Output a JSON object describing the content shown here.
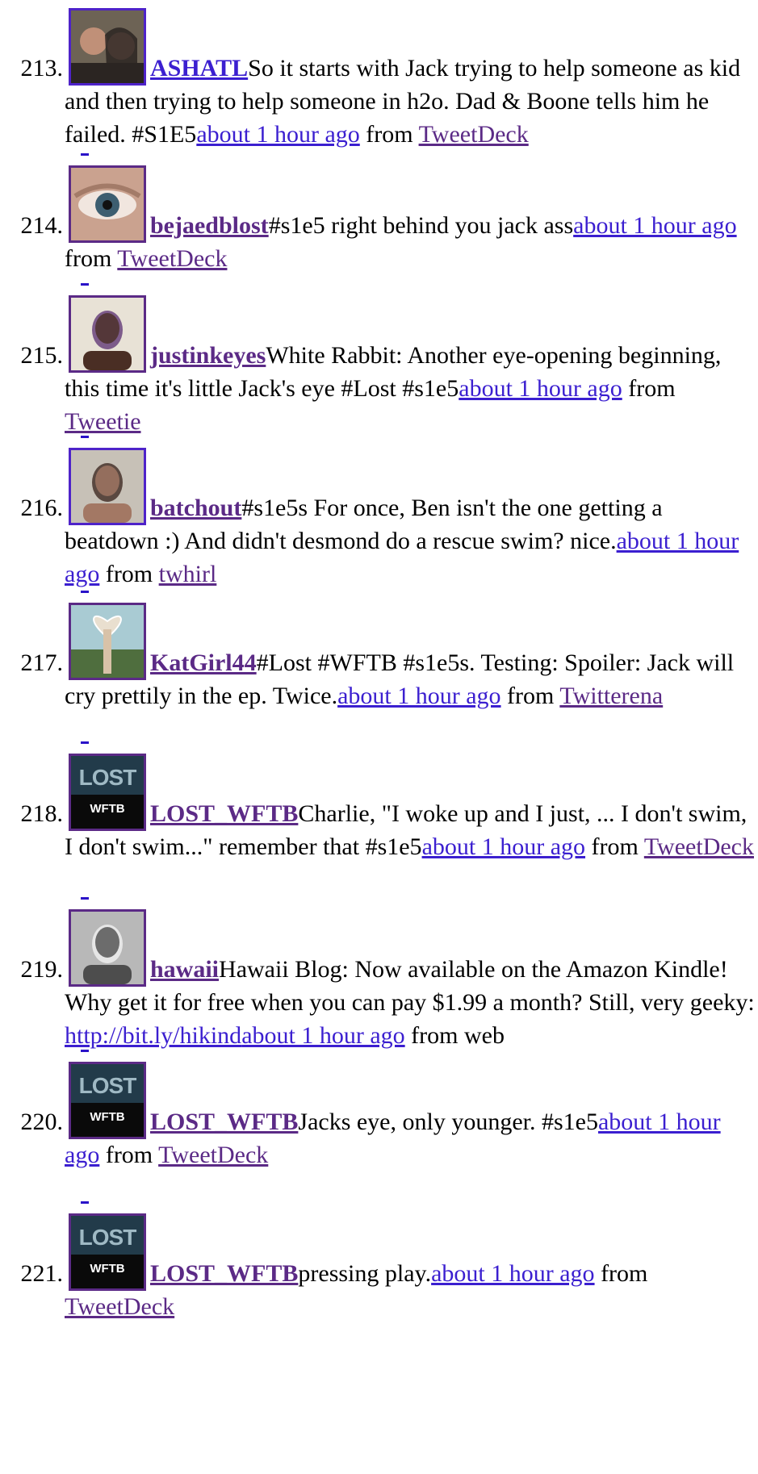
{
  "tweets": [
    {
      "num": "213.",
      "user": "ASHATL",
      "text": "So it starts with Jack trying to help someone as kid and then trying to help someone in h2o. Dad & Boone tells him he failed. #S1E5",
      "time": "about 1 hour ago",
      "from": "from",
      "source": "TweetDeck",
      "source_is_link": true,
      "avatar_icon": "photo-couple-avatar",
      "avatar_colors": [
        "#6d6355",
        "#2b2522",
        "#8c7f6e"
      ]
    },
    {
      "num": "214.",
      "user": "bejaedblost",
      "text": "#s1e5 right behind you jack ass",
      "time": "about 1 hour ago",
      "from": "from",
      "source": "TweetDeck",
      "source_is_link": true,
      "avatar_icon": "eye-closeup-avatar",
      "avatar_colors": [
        "#caa28f",
        "#3d5e70",
        "#a37b68"
      ]
    },
    {
      "num": "215.",
      "user": "justinkeyes",
      "text": "White Rabbit: Another eye-opening beginning, this time it's little Jack's eye #Lost #s1e5",
      "time": "about 1 hour ago",
      "from": "from",
      "source": "Tweetie",
      "source_is_link": true,
      "avatar_icon": "portrait-man-avatar",
      "avatar_colors": [
        "#e8e2d6",
        "#4a2e24",
        "#7d5b8a"
      ]
    },
    {
      "num": "216.",
      "user": "batchout",
      "text": "#s1e5s For once, Ben isn't the one getting a beatdown :) And didn't desmond do a rescue swim? nice.",
      "time": "about 1 hour ago",
      "from": "from",
      "source": "twhirl",
      "source_is_link": true,
      "avatar_icon": "portrait-man-avatar",
      "avatar_colors": [
        "#c7c1b7",
        "#a37864",
        "#5a4840"
      ]
    },
    {
      "num": "217.",
      "user": "KatGirl44",
      "text": "#Lost #WFTB #s1e5s. Testing: Spoiler: Jack will cry prettily in the ep. Twice.",
      "time": "about 1 hour ago",
      "from": "from",
      "source": "Twitterena",
      "source_is_link": true,
      "avatar_icon": "heart-hands-avatar",
      "avatar_colors": [
        "#a9cbd3",
        "#d8c2a8",
        "#4f6e3e"
      ]
    },
    {
      "num": "218.",
      "user": "LOST_WFTB",
      "text": "Charlie, \"I woke up and I just, ... I don't swim, I don't swim...\" remember that #s1e5",
      "time": "about 1 hour ago",
      "from": "from",
      "source": "TweetDeck",
      "source_is_link": true,
      "avatar_icon": "lost-wftb-logo-avatar",
      "avatar_colors": [
        "#223b4a",
        "#0a0a0a",
        "#9fb9c4"
      ]
    },
    {
      "num": "219.",
      "user": "hawaii",
      "text": "Hawaii Blog: Now available on the Amazon Kindle! Why get it for free when you can pay $1.99 a month? Still, very geeky: ",
      "link": "http://bit.ly/hikind",
      "time": "about 1 hour ago",
      "from": "from",
      "source": "web",
      "source_is_link": false,
      "avatar_icon": "portrait-man-bw-avatar",
      "avatar_colors": [
        "#b8b8b8",
        "#4d4d4d",
        "#e6e6e6"
      ]
    },
    {
      "num": "220.",
      "user": "LOST_WFTB",
      "text": "Jacks eye, only younger. #s1e5",
      "time": "about 1 hour ago",
      "from": "from",
      "source": "TweetDeck",
      "source_is_link": true,
      "avatar_icon": "lost-wftb-logo-avatar",
      "avatar_colors": [
        "#223b4a",
        "#0a0a0a",
        "#9fb9c4"
      ]
    },
    {
      "num": "221.",
      "user": "LOST_WFTB",
      "text": "pressing play.",
      "time": "about 1 hour ago",
      "from": "from",
      "source": "TweetDeck",
      "source_is_link": true,
      "avatar_icon": "lost-wftb-logo-avatar",
      "avatar_colors": [
        "#223b4a",
        "#0a0a0a",
        "#9fb9c4"
      ]
    }
  ],
  "logo_text": {
    "top": "LOST",
    "bottom": "WFTB"
  }
}
